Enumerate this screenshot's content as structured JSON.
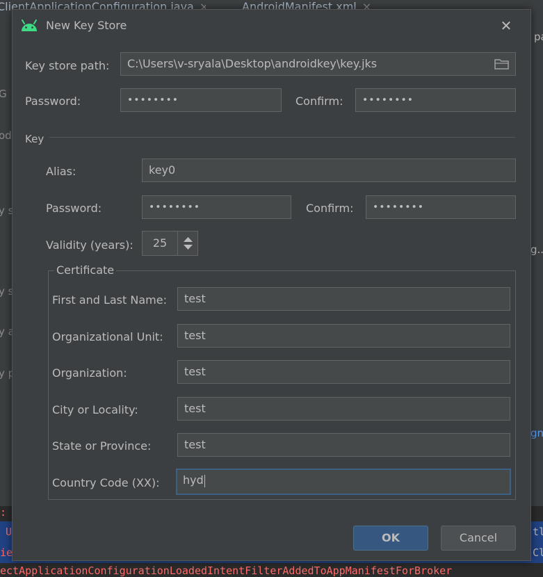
{
  "background": {
    "tabs": [
      {
        "label": "ClientApplicationConfiguration.java",
        "close": "×"
      },
      {
        "label": "AndroidManifest.xml",
        "close": "×"
      }
    ],
    "right_fragments": [
      "pa",
      "g...",
      "gni",
      "tl",
      "Cli"
    ],
    "left_fragments": [
      "G",
      "odu",
      "y s",
      "y s",
      "y a",
      "y p"
    ],
    "console_lines": [
      ":",
      "U",
      "ie",
      "ectApplicationConfigurationLoadedIntentFilterAddedToAppManifestForBroker"
    ]
  },
  "dialog": {
    "title": "New Key Store",
    "close_glyph": "✕",
    "key_store_path_label": "Key store path:",
    "key_store_path_value": "C:\\Users\\v-sryala\\Desktop\\androidkey\\key.jks",
    "password_label": "Password:",
    "password_value": "••••••••",
    "confirm_label": "Confirm:",
    "confirm_value": "••••••••",
    "key_section_label": "Key",
    "key": {
      "alias_label": "Alias:",
      "alias_value": "key0",
      "password_label": "Password:",
      "password_value": "••••••••",
      "confirm_label": "Confirm:",
      "confirm_value": "••••••••",
      "validity_label": "Validity (years):",
      "validity_value": "25"
    },
    "certificate": {
      "legend": "Certificate",
      "first_last_name_label": "First and Last Name:",
      "first_last_name_value": "test",
      "org_unit_label": "Organizational Unit:",
      "org_unit_value": "test",
      "organization_label": "Organization:",
      "organization_value": "test",
      "city_label": "City or Locality:",
      "city_value": "test",
      "state_label": "State or Province:",
      "state_value": "test",
      "country_label": "Country Code (XX):",
      "country_value": "hyd"
    },
    "ok_label": "OK",
    "cancel_label": "Cancel"
  },
  "colors": {
    "accent": "#365880",
    "android_green": "#3ddc84",
    "focus_border": "#3d6185"
  }
}
